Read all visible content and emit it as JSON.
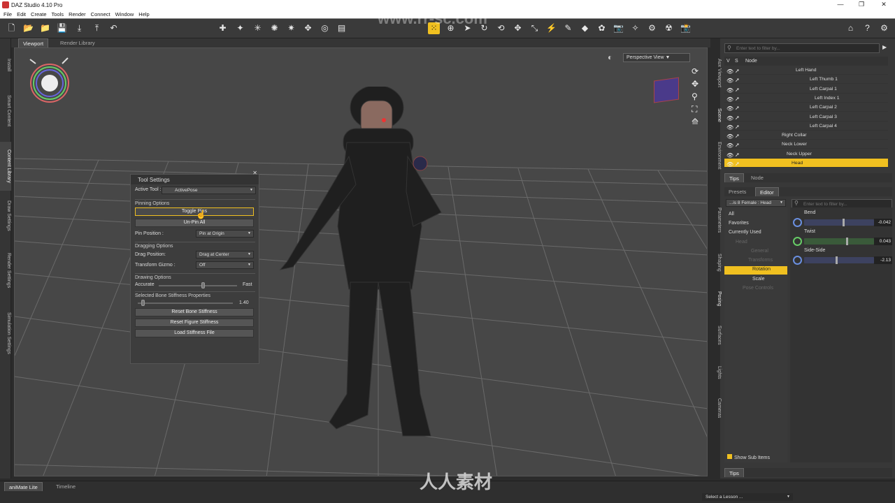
{
  "window": {
    "title": "DAZ Studio 4.10 Pro"
  },
  "menu": [
    "File",
    "Edit",
    "Create",
    "Tools",
    "Render",
    "Connect",
    "Window",
    "Help"
  ],
  "left_tabs": [
    "Install",
    "Smart Content",
    "Content Library",
    "Draw Settings",
    "Render Settings",
    "Simulation Settings"
  ],
  "view_tabs": {
    "viewport": "Viewport",
    "render_library": "Render Library"
  },
  "viewport": {
    "view_select": "Perspective View"
  },
  "tool_settings": {
    "title": "Tool Settings",
    "active_tool_label": "Active Tool :",
    "active_tool_value": "ActivePose",
    "pinning_options": "Pinning Options",
    "toggle_pins": "Toggle Pins",
    "unpin_all": "Un-Pin All",
    "pin_position_label": "Pin Position :",
    "pin_position_value": "Pin at Origin",
    "dragging_options": "Dragging Options",
    "drag_position_label": "Drag Position:",
    "drag_position_value": "Drag at Center",
    "transform_gizmo_label": "Transform Gizmo :",
    "transform_gizmo_value": "Off",
    "drawing_options": "Drawing Options",
    "accurate_label": "Accurate",
    "fast_label": "Fast",
    "bone_stiffness_title": "Selected Bone Stiffness Properties",
    "bone_stiffness_value": "1.40",
    "reset_bone": "Reset Bone Stiffness",
    "reset_figure": "Reset Figure Stiffness",
    "load_stiffness": "Load Stiffness File"
  },
  "scene": {
    "filter_placeholder": "Enter text to filter by...",
    "col_v": "V",
    "col_s": "S",
    "col_node": "Node",
    "nodes": [
      {
        "name": "Left Hand",
        "indent": 102
      },
      {
        "name": "Left Thumb 1",
        "indent": 122
      },
      {
        "name": "Left Carpal 1",
        "indent": 122
      },
      {
        "name": "Left Index 1",
        "indent": 129
      },
      {
        "name": "Left Carpal 2",
        "indent": 122
      },
      {
        "name": "Left Carpal 3",
        "indent": 122
      },
      {
        "name": "Left Carpal 4",
        "indent": 122
      },
      {
        "name": "Right Collar",
        "indent": 82
      },
      {
        "name": "Neck Lower",
        "indent": 82
      },
      {
        "name": "Neck Upper",
        "indent": 89
      },
      {
        "name": "Head",
        "indent": 96
      }
    ],
    "tabs": {
      "tips": "Tips",
      "node": "Node"
    }
  },
  "right_side_tabs": [
    "Aux Viewport",
    "Scene",
    "Environment",
    "Parameters",
    "Shaping",
    "Posing",
    "Surfaces",
    "Lights",
    "Cameras"
  ],
  "parameters": {
    "tabs": {
      "presets": "Presets",
      "editor": "Editor"
    },
    "node_select": "...is 8 Female : Head",
    "filter_placeholder": "Enter text to filter by...",
    "list": [
      "All",
      "Favorites",
      "Currently Used"
    ],
    "tree": [
      "Head",
      "General",
      "Transforms",
      "Rotation",
      "Scale",
      "Pose Controls"
    ],
    "sliders": [
      {
        "label": "Bend",
        "value": "-0.042",
        "color": "#3d4260",
        "knob": 0.55
      },
      {
        "label": "Twist",
        "value": "0.043",
        "color": "#3a5a3a",
        "knob": 0.6
      },
      {
        "label": "Side-Side",
        "value": "-2.13",
        "color": "#3d4260",
        "knob": 0.45
      }
    ],
    "show_sub_items": "Show Sub Items",
    "tips": "Tips"
  },
  "bottom": {
    "animate": "aniMate Lite",
    "timeline": "Timeline",
    "lesson": "Select a Lesson ..."
  },
  "watermarks": {
    "url": "www.rr-sc.com",
    "brand": "人人素材"
  },
  "colors": {
    "accent": "#f0c020",
    "panel": "#383838",
    "viewport": "#474747"
  }
}
